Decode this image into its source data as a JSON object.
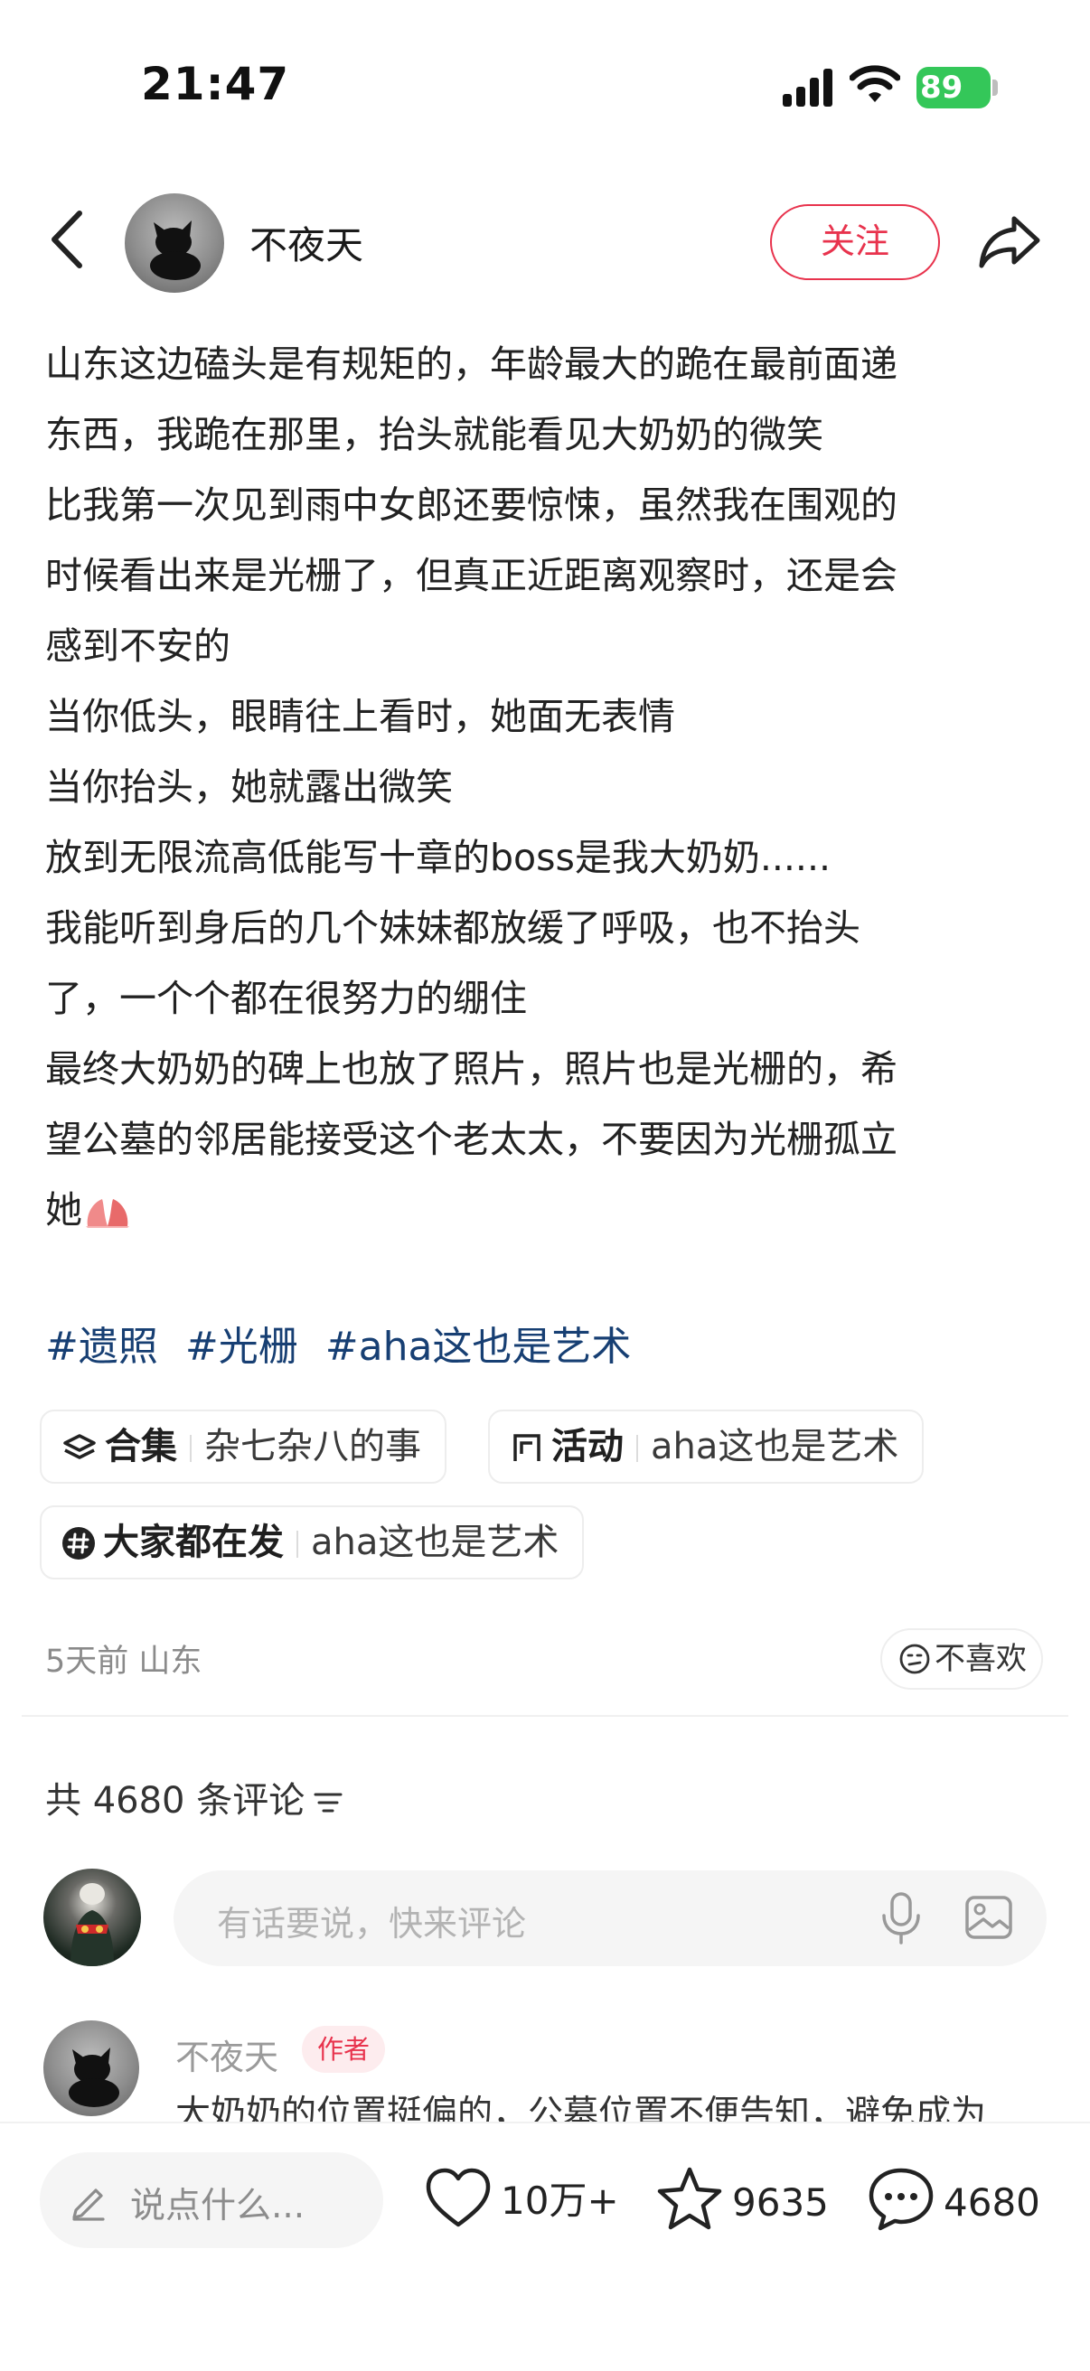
{
  "status_bar": {
    "time": "21:47",
    "battery": "89"
  },
  "header": {
    "author": "不夜天",
    "follow_label": "关注"
  },
  "post": {
    "lines": [
      "山东这边磕头是有规矩的，年龄最大的跪在最前面递",
      "东西，我跪在那里，抬头就能看见大奶奶的微笑",
      "比我第一次见到雨中女郎还要惊悚，虽然我在围观的",
      "时候看出来是光栅了，但真正近距离观察时，还是会",
      "感到不安的",
      "当你低头，眼睛往上看时，她面无表情",
      "当你抬头，她就露出微笑",
      "放到无限流高低能写十章的boss是我大奶奶......",
      "我能听到身后的几个妹妹都放缓了呼吸，也不抬头",
      "了，一个个都在很努力的绷住",
      "最终大奶奶的碑上也放了照片，照片也是光栅的，希",
      "望公墓的邻居能接受这个老太太，不要因为光栅孤立",
      "她"
    ],
    "tags": [
      "#遗照",
      "#光栅",
      "#aha这也是艺术"
    ]
  },
  "chips": [
    {
      "icon": "layers-icon",
      "label": "合集",
      "value": "杂七杂八的事"
    },
    {
      "icon": "activity-icon",
      "label": "活动",
      "value": "aha这也是艺术"
    },
    {
      "icon": "hash-icon",
      "label": "大家都在发",
      "value": "aha这也是艺术"
    }
  ],
  "meta": {
    "time_location": "5天前 山东",
    "dislike_label": "不喜欢"
  },
  "comments": {
    "count_label": "共 4680 条评论",
    "input_placeholder": "有话要说，快来评论",
    "first": {
      "user": "不夜天",
      "badge": "作者",
      "text": "大奶奶的位置挺偏的，公墓位置不便告知，避免成为"
    }
  },
  "bottom_bar": {
    "say_placeholder": "说点什么...",
    "likes": "10万+",
    "favorites": "9635",
    "comments": "4680"
  },
  "colors": {
    "accent": "#e8334d",
    "tag": "#173f73",
    "battery": "#34c759"
  }
}
